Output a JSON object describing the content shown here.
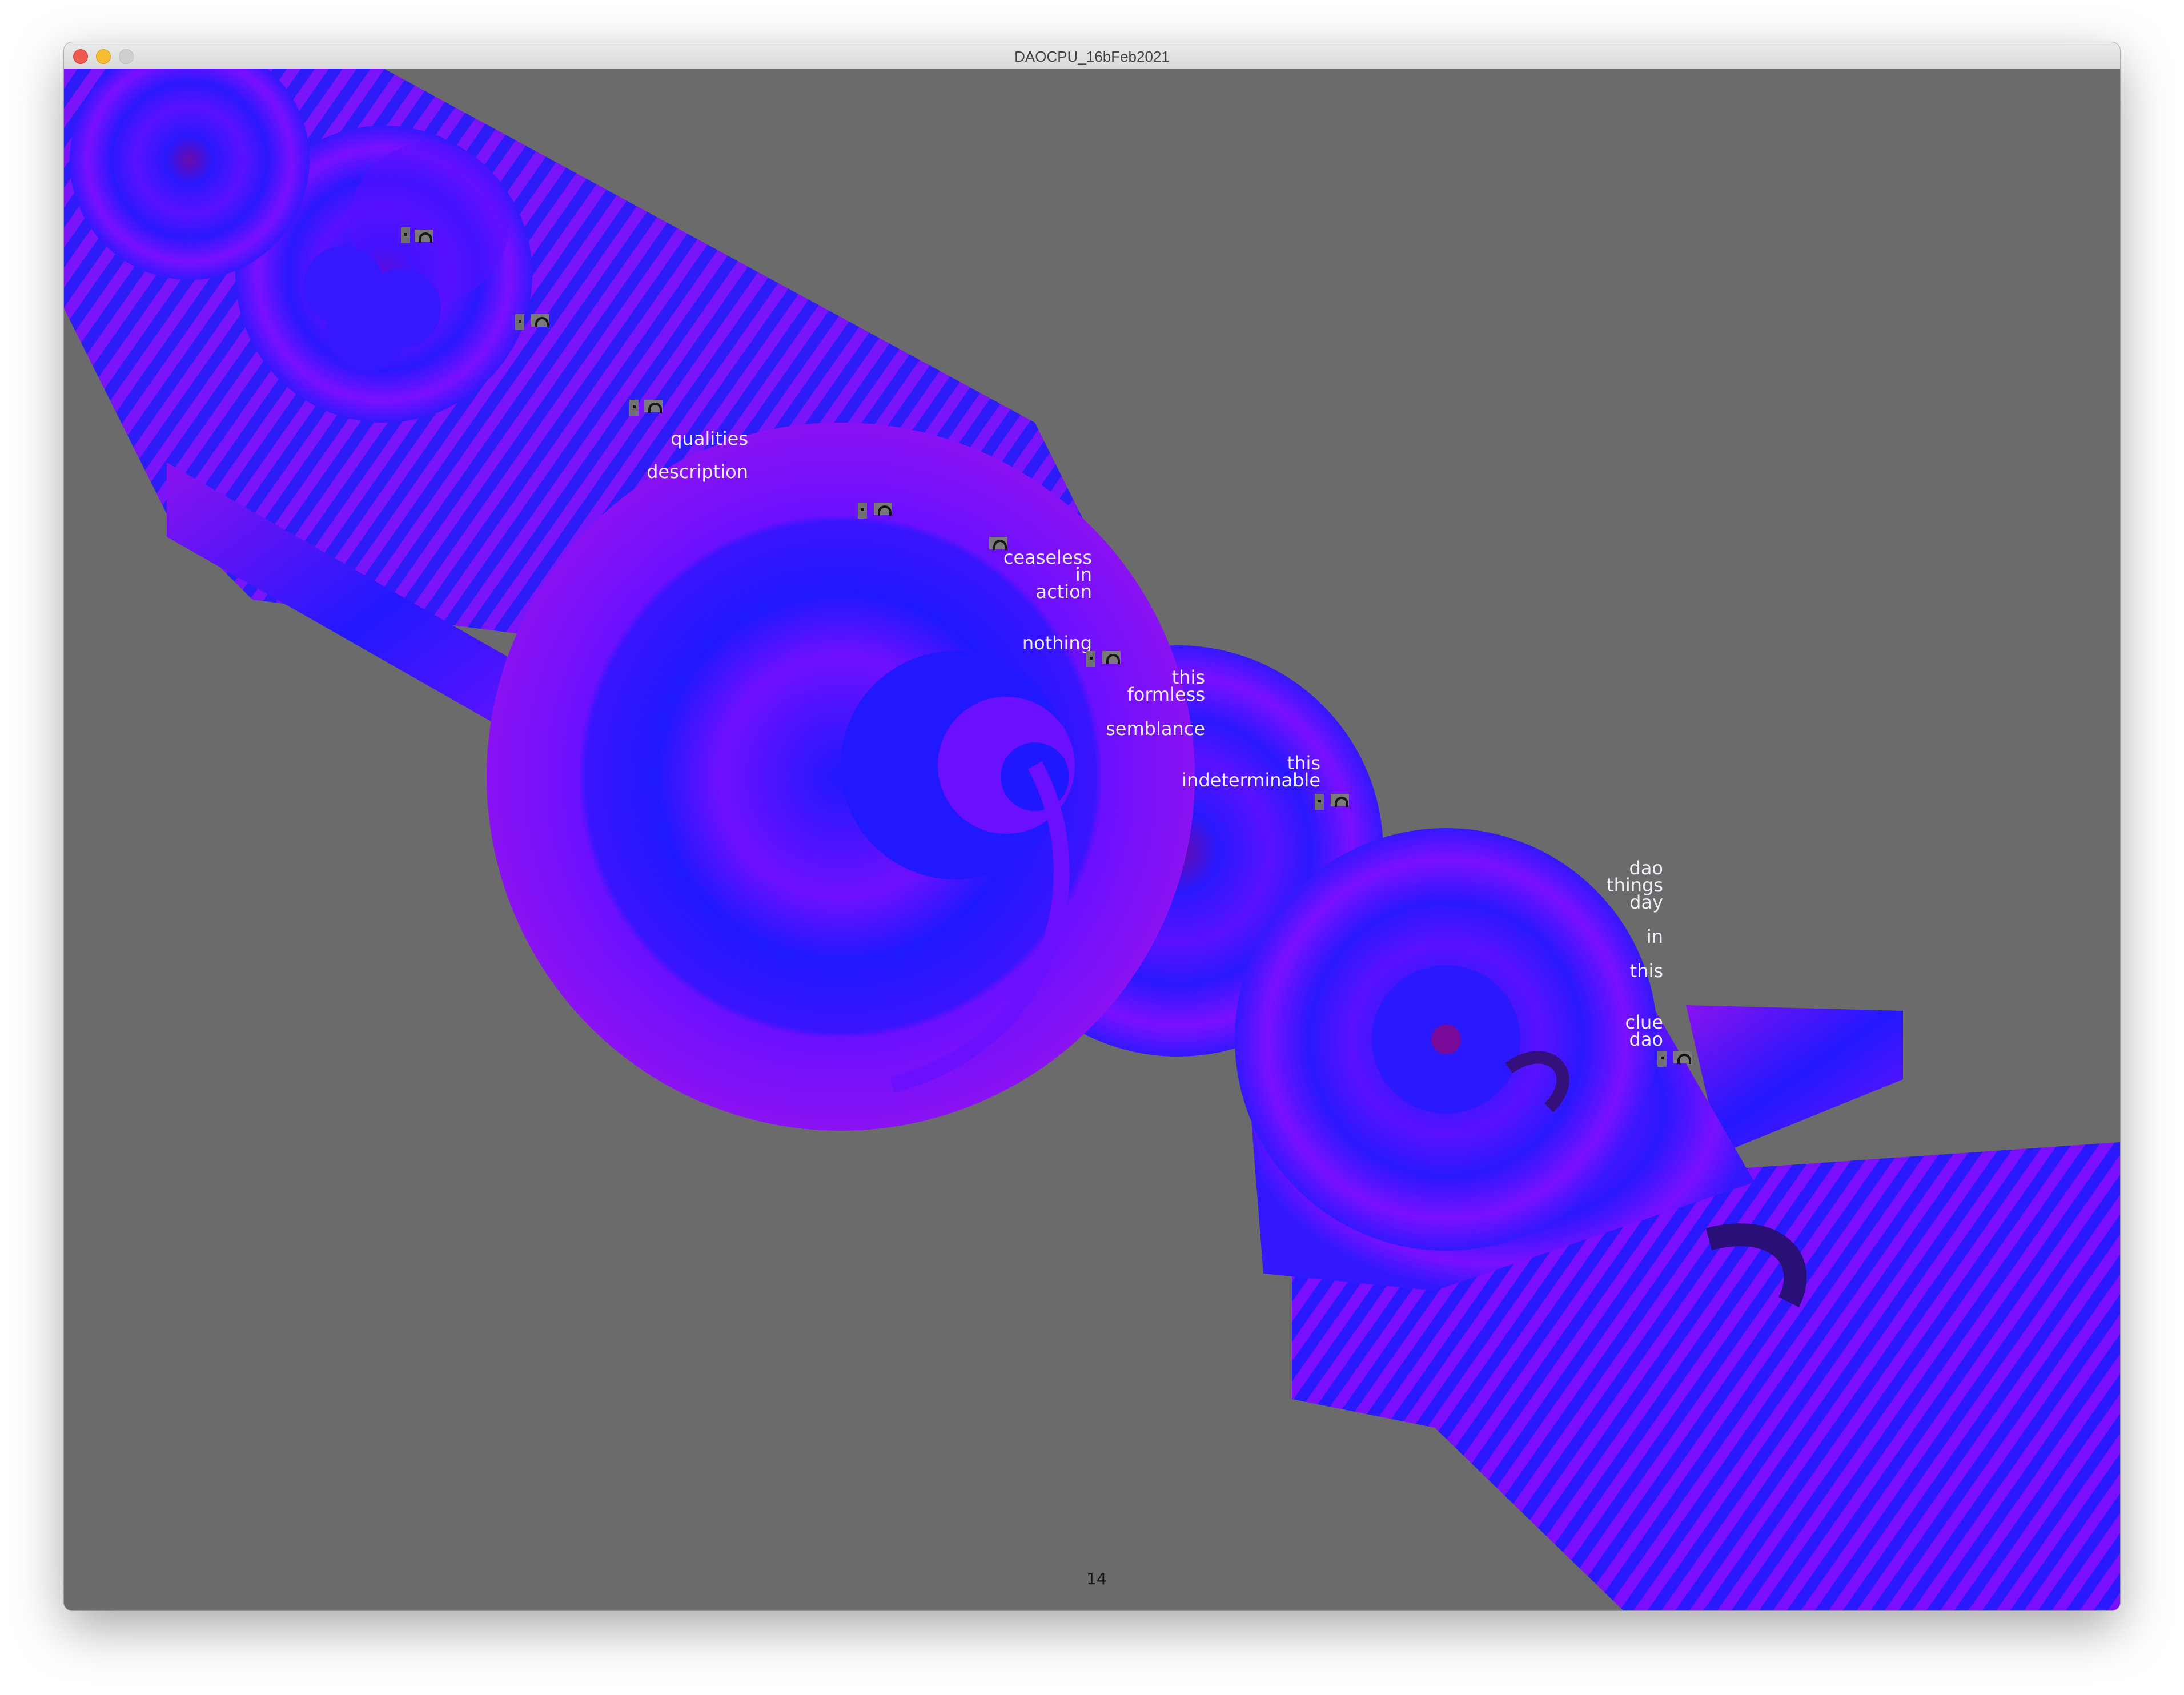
{
  "window": {
    "title": "DAOCPU_16bFeb2021",
    "controls": [
      "close",
      "minimize",
      "zoom"
    ]
  },
  "canvas": {
    "background": "#6b6b6b",
    "palette": [
      "#1f18ff",
      "#4a10ff",
      "#7a10ff",
      "#9a12ee",
      "#4f0a7a"
    ],
    "words": [
      {
        "text": "qualities"
      },
      {
        "text": "description"
      },
      {
        "text": "ceaseless"
      },
      {
        "text": "in"
      },
      {
        "text": "action"
      },
      {
        "text": "nothing"
      },
      {
        "text": "this"
      },
      {
        "text": "formless"
      },
      {
        "text": "semblance"
      },
      {
        "text": "this"
      },
      {
        "text": "indeterminable"
      },
      {
        "text": "dao"
      },
      {
        "text": "things"
      },
      {
        "text": "day"
      },
      {
        "text": "in"
      },
      {
        "text": "this"
      },
      {
        "text": "clue"
      },
      {
        "text": "dao"
      }
    ],
    "frame_counter": "14"
  }
}
